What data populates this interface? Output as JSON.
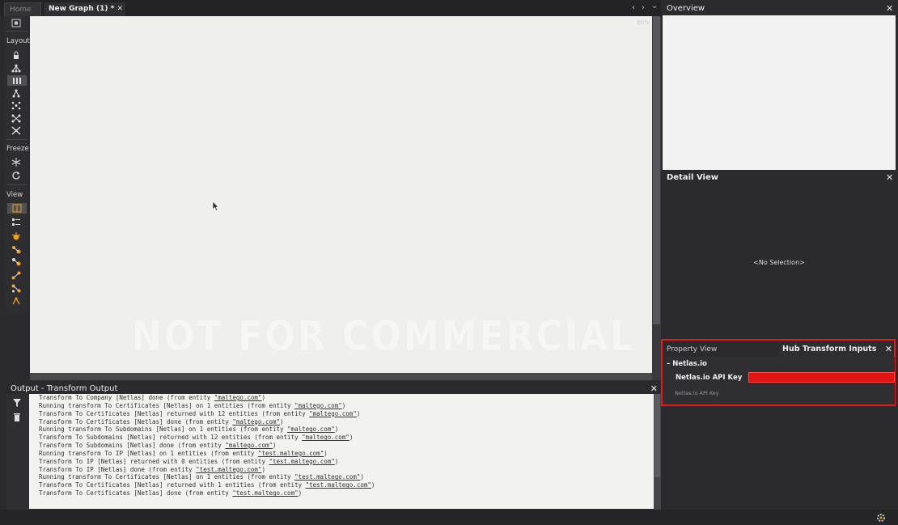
{
  "tabs": [
    {
      "label": "Home",
      "active": false
    },
    {
      "label": "New Graph (1) *",
      "active": true,
      "close": "✕"
    }
  ],
  "nav": {
    "prev": "‹",
    "next": "›",
    "menu": "⌄"
  },
  "toolbar": {
    "sections": [
      {
        "label": "Layout",
        "buttons": [
          "lock-icon",
          "hierarchy-icon",
          "block-layout-icon",
          "tree-icon",
          "organic-icon",
          "circular-icon",
          "interactive-icon"
        ]
      },
      {
        "label": "Freeze",
        "buttons": [
          "snowflake-icon",
          "refresh-icon"
        ]
      },
      {
        "label": "View",
        "buttons": [
          "graph-view-icon",
          "list-view-icon",
          "bulb-icon",
          "node-size-icon",
          "node-color-icon",
          "link-icon",
          "link-size-icon",
          "link-color-icon"
        ]
      }
    ]
  },
  "canvas": {
    "zoom": "80%",
    "watermark": "NOT FOR COMMERCIAL USE"
  },
  "output": {
    "title": "Output - Transform Output",
    "close": "✕",
    "lines": [
      {
        "text": "Transform To Company [Netlas] done (from entity ",
        "entity": "\"maltego.com\"",
        "end": ")"
      },
      {
        "text": "Running transform To Certificates [Netlas] on 1 entities (from entity ",
        "entity": "\"maltego.com\"",
        "end": ")"
      },
      {
        "text": "Transform To Certificates [Netlas] returned with 12 entities (from entity ",
        "entity": "\"maltego.com\"",
        "end": ")"
      },
      {
        "text": "Transform To Certificates [Netlas] done (from entity ",
        "entity": "\"maltego.com\"",
        "end": ")"
      },
      {
        "text": "Running transform To Subdomains [Netlas] on 1 entities (from entity ",
        "entity": "\"maltego.com\"",
        "end": ")"
      },
      {
        "text": "Transform To Subdomains [Netlas] returned with 12 entities (from entity ",
        "entity": "\"maltego.com\"",
        "end": ")"
      },
      {
        "text": "Transform To Subdomains [Netlas] done (from entity ",
        "entity": "\"maltego.com\"",
        "end": ")"
      },
      {
        "text": "Running transform To IP [Netlas] on 1 entities (from entity ",
        "entity": "\"test.maltego.com\"",
        "end": ")"
      },
      {
        "text": "Transform To IP [Netlas] returned with 0 entities (from entity ",
        "entity": "\"test.maltego.com\"",
        "end": ")"
      },
      {
        "text": "Transform To IP [Netlas] done (from entity ",
        "entity": "\"test.maltego.com\"",
        "end": ")"
      },
      {
        "text": "Running transform To Certificates [Netlas] on 1 entities (from entity ",
        "entity": "\"test.maltego.com\"",
        "end": ")"
      },
      {
        "text": "Transform To Certificates [Netlas] returned with 1 entities (from entity ",
        "entity": "\"test.maltego.com\"",
        "end": ")"
      },
      {
        "text": "Transform To Certificates [Netlas] done (from entity ",
        "entity": "\"test.maltego.com\"",
        "end": ")"
      }
    ]
  },
  "overview": {
    "title": "Overview",
    "close": "✕"
  },
  "detail": {
    "title": "Detail View",
    "close": "✕",
    "empty": "<No Selection>"
  },
  "property": {
    "tab_property": "Property View",
    "tab_hub": "Hub Transform Inputs",
    "close": "✕",
    "category": "Netlas.io",
    "collapse": "–",
    "key_label": "Netlas.io API Key",
    "key_value": "",
    "key_desc": "Netlas.io API Key"
  },
  "colors": {
    "highlight": "#e31b1b",
    "accent_orange": "#f0a020"
  }
}
